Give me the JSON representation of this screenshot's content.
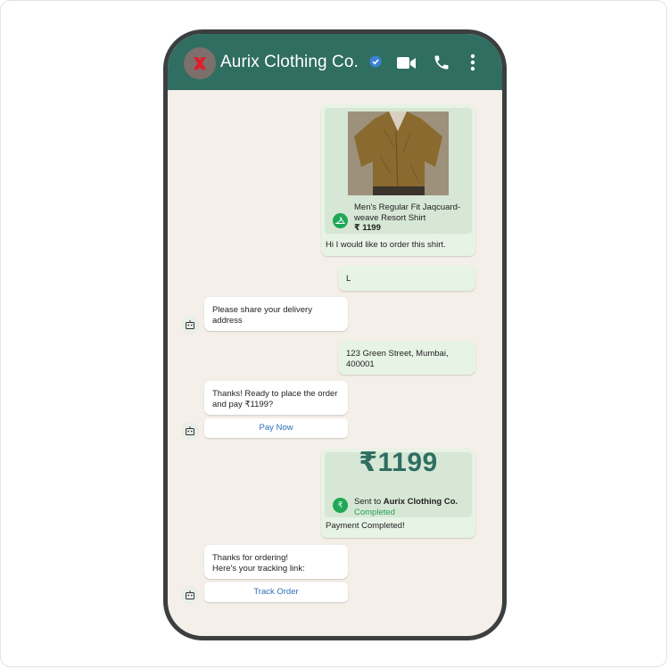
{
  "header": {
    "contact_name": "Aurix Clothing Co.",
    "header_color": "#2f6e61",
    "icons": [
      "aurix-logo-icon",
      "verified-icon",
      "video-call-icon",
      "phone-call-icon",
      "more-options-icon"
    ]
  },
  "chat": {
    "background": "#f5efe9",
    "product": {
      "name": "Men's Regular Fit Jaqcuard-weave Resort Shirt",
      "price": "₹ 1199",
      "icon": "hanger-icon"
    },
    "messages": {
      "order_request": "Hi I would like to order this shirt.",
      "size_reply": "L",
      "ask_address": "Please share your delivery address",
      "address_reply": "123 Green Street, Mumbai, 400001",
      "confirm_order": "Thanks! Ready to place the order and pay ₹1199?",
      "pay_now_button": "Pay Now",
      "payment_note": "Payment Completed!",
      "thanks_ordering": "Thanks for ordering!\n Here's your tracking link:",
      "track_order_button": "Track Order"
    },
    "payment": {
      "amount": "₹1199",
      "sent_to_prefix": "Sent to ",
      "sent_to_name": "Aurix Clothing Co.",
      "status": "Completed",
      "icon": "rupee-icon"
    },
    "bot_icon": "robot-icon"
  }
}
